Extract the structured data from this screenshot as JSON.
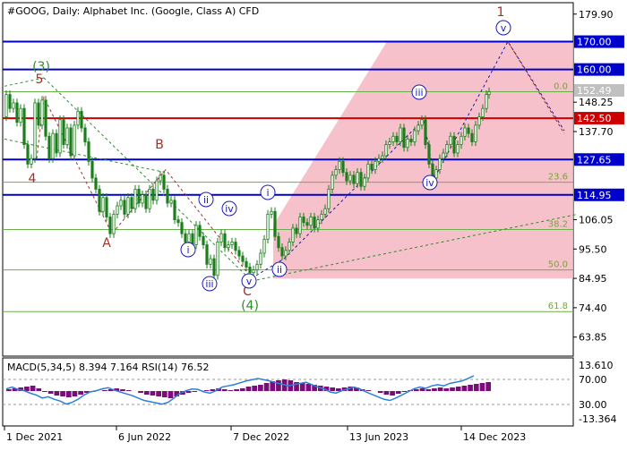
{
  "header": {
    "title": "#GOOG, Daily:  Alphabet Inc. (Google, Class A) CFD"
  },
  "indicator": {
    "label": "MACD(5,34,5) 8.394 7.164 RSI(14) 76.52"
  },
  "colors": {
    "frame": "#000000",
    "candle": "#1a7f1a",
    "hline_blue": "#0000cc",
    "hline_red": "#cc0000",
    "fib_line": "#6ab04c",
    "fib_text": "#7aa33a",
    "wave_major": "#a0302a",
    "wave_minor": "#1b1bb3",
    "wave_green": "#2e8b2e",
    "forecast_fill": "#f4b6c2",
    "macd_hist": "#7a0d7a",
    "rsi_line": "#2f7fd8",
    "price_tag": "#c0c0c0"
  },
  "chart_data": [
    {
      "type": "candlestick",
      "symbol": "#GOOG",
      "timeframe": "Daily",
      "title": "#GOOG, Daily:  Alphabet Inc. (Google, Class A) CFD",
      "price_axis_ticks": [
        "179.90",
        "170.00",
        "160.00",
        "152.49",
        "148.25",
        "142.50",
        "137.70",
        "127.65",
        "114.95",
        "106.05",
        "95.50",
        "84.95",
        "74.40",
        "63.85"
      ],
      "time_axis_ticks": [
        "1 Dec 2021",
        "6 Jun 2022",
        "7 Dec 2022",
        "13 Jun 2023",
        "14 Dec 2023"
      ],
      "ylim": [
        57.0,
        184.0
      ],
      "current_price": 152.49,
      "levels": [
        {
          "value": 170.0,
          "color": "blue"
        },
        {
          "value": 160.0,
          "color": "blue"
        },
        {
          "value": 142.5,
          "color": "red"
        },
        {
          "value": 127.65,
          "color": "blue"
        },
        {
          "value": 114.95,
          "color": "blue"
        }
      ],
      "fibonacci": [
        {
          "label": "0.0",
          "value": 152.0
        },
        {
          "label": "23.6",
          "value": 119.5
        },
        {
          "label": "38.2",
          "value": 102.5
        },
        {
          "label": "50.0",
          "value": 88.0
        },
        {
          "label": "61.8",
          "value": 73.0
        }
      ],
      "wave_labels_major": [
        "1",
        "5",
        "4",
        "A",
        "B",
        "C"
      ],
      "wave_labels_minor": [
        "i",
        "ii",
        "iii",
        "iv",
        "v",
        "ii",
        "iii",
        "iv",
        "v"
      ],
      "wave_labels_green": [
        "(3)",
        "(4)"
      ],
      "price_path": [
        [
          0,
          143
        ],
        [
          4,
          151
        ],
        [
          8,
          146
        ],
        [
          12,
          148
        ],
        [
          16,
          141
        ],
        [
          20,
          146
        ],
        [
          24,
          133
        ],
        [
          28,
          126
        ],
        [
          32,
          128
        ],
        [
          36,
          148
        ],
        [
          40,
          140
        ],
        [
          44,
          149
        ],
        [
          48,
          136
        ],
        [
          52,
          128
        ],
        [
          56,
          137
        ],
        [
          60,
          130
        ],
        [
          64,
          142
        ],
        [
          68,
          133
        ],
        [
          72,
          139
        ],
        [
          76,
          129
        ],
        [
          80,
          140
        ],
        [
          84,
          145
        ],
        [
          88,
          139
        ],
        [
          92,
          134
        ],
        [
          96,
          127
        ],
        [
          100,
          121
        ],
        [
          104,
          117
        ],
        [
          108,
          109
        ],
        [
          112,
          114
        ],
        [
          116,
          107
        ],
        [
          120,
          101
        ],
        [
          124,
          108
        ],
        [
          128,
          111
        ],
        [
          132,
          113
        ],
        [
          136,
          108
        ],
        [
          140,
          114
        ],
        [
          144,
          110
        ],
        [
          148,
          117
        ],
        [
          152,
          112
        ],
        [
          156,
          115
        ],
        [
          160,
          110
        ],
        [
          164,
          117
        ],
        [
          168,
          113
        ],
        [
          172,
          120
        ],
        [
          176,
          122
        ],
        [
          180,
          117
        ],
        [
          184,
          112
        ],
        [
          188,
          113
        ],
        [
          192,
          106
        ],
        [
          196,
          105
        ],
        [
          200,
          101
        ],
        [
          204,
          98
        ],
        [
          208,
          101
        ],
        [
          212,
          97
        ],
        [
          216,
          104
        ],
        [
          220,
          100
        ],
        [
          224,
          97
        ],
        [
          228,
          90
        ],
        [
          232,
          92
        ],
        [
          236,
          86
        ],
        [
          240,
          98
        ],
        [
          244,
          101
        ],
        [
          248,
          96
        ],
        [
          252,
          97
        ],
        [
          256,
          98
        ],
        [
          260,
          95
        ],
        [
          264,
          93
        ],
        [
          268,
          91
        ],
        [
          272,
          89
        ],
        [
          276,
          87
        ],
        [
          280,
          88
        ],
        [
          284,
          90
        ],
        [
          288,
          94
        ],
        [
          292,
          99
        ],
        [
          296,
          108
        ],
        [
          300,
          109
        ],
        [
          304,
          100
        ],
        [
          308,
          96
        ],
        [
          312,
          93
        ],
        [
          316,
          95
        ],
        [
          320,
          98
        ],
        [
          324,
          103
        ],
        [
          328,
          101
        ],
        [
          332,
          107
        ],
        [
          336,
          105
        ],
        [
          340,
          104
        ],
        [
          344,
          107
        ],
        [
          348,
          103
        ],
        [
          352,
          106
        ],
        [
          356,
          108
        ],
        [
          360,
          110
        ],
        [
          364,
          117
        ],
        [
          368,
          122
        ],
        [
          372,
          124
        ],
        [
          376,
          127
        ],
        [
          380,
          123
        ],
        [
          384,
          120
        ],
        [
          388,
          122
        ],
        [
          392,
          119
        ],
        [
          396,
          123
        ],
        [
          400,
          118
        ],
        [
          404,
          121
        ],
        [
          408,
          126
        ],
        [
          412,
          124
        ],
        [
          416,
          127
        ],
        [
          420,
          128
        ],
        [
          424,
          129
        ],
        [
          428,
          133
        ],
        [
          432,
          134
        ],
        [
          436,
          136
        ],
        [
          440,
          134
        ],
        [
          444,
          139
        ],
        [
          448,
          132
        ],
        [
          452,
          135
        ],
        [
          456,
          134
        ],
        [
          460,
          138
        ],
        [
          464,
          140
        ],
        [
          468,
          142
        ],
        [
          472,
          133
        ],
        [
          476,
          126
        ],
        [
          480,
          121
        ],
        [
          484,
          124
        ],
        [
          488,
          128
        ],
        [
          492,
          130
        ],
        [
          496,
          133
        ],
        [
          500,
          136
        ],
        [
          504,
          130
        ],
        [
          508,
          133
        ],
        [
          512,
          136
        ],
        [
          516,
          139
        ],
        [
          520,
          137
        ],
        [
          524,
          134
        ],
        [
          528,
          140
        ],
        [
          532,
          143
        ],
        [
          536,
          146
        ],
        [
          540,
          151
        ],
        [
          542,
          152
        ]
      ]
    },
    {
      "type": "line",
      "title": "MACD(5,34,5) 8.394 7.164 RSI(14) 76.52",
      "y_axis_ticks": [
        "13.610",
        "70.00",
        "30.00",
        "-13.364"
      ],
      "series": [
        {
          "name": "MACD",
          "values": [
            2,
            3,
            4,
            5,
            6,
            3,
            -1,
            -3,
            -5,
            -6,
            -7,
            -6,
            -4,
            -2,
            -1,
            0,
            1,
            2,
            3,
            2,
            1,
            0,
            -2,
            -4,
            -5,
            -6,
            -7,
            -8,
            -6,
            -4,
            -2,
            -1,
            0,
            1,
            2,
            3,
            2,
            1,
            2,
            3,
            5,
            6,
            7,
            9,
            11,
            12,
            13,
            12,
            10,
            9,
            8,
            7,
            6,
            5,
            4,
            3,
            4,
            5,
            4,
            2,
            1,
            0,
            -2,
            -4,
            -5,
            -3,
            -1,
            1,
            2,
            3,
            2,
            3,
            4,
            3,
            4,
            5,
            6,
            7,
            8,
            9,
            10
          ]
        },
        {
          "name": "RSI(14)",
          "values": [
            55,
            58,
            54,
            52,
            48,
            45,
            40,
            42,
            38,
            35,
            30,
            33,
            38,
            45,
            50,
            52,
            55,
            57,
            53,
            50,
            47,
            44,
            40,
            36,
            34,
            32,
            30,
            33,
            40,
            48,
            52,
            55,
            54,
            50,
            48,
            52,
            58,
            60,
            62,
            65,
            68,
            70,
            72,
            70,
            68,
            65,
            63,
            60,
            62,
            64,
            66,
            62,
            58,
            55,
            50,
            48,
            52,
            55,
            58,
            55,
            50,
            46,
            42,
            38,
            36,
            40,
            45,
            50,
            55,
            58,
            56,
            60,
            62,
            60,
            64,
            66,
            68,
            72,
            76.52
          ]
        }
      ]
    }
  ]
}
